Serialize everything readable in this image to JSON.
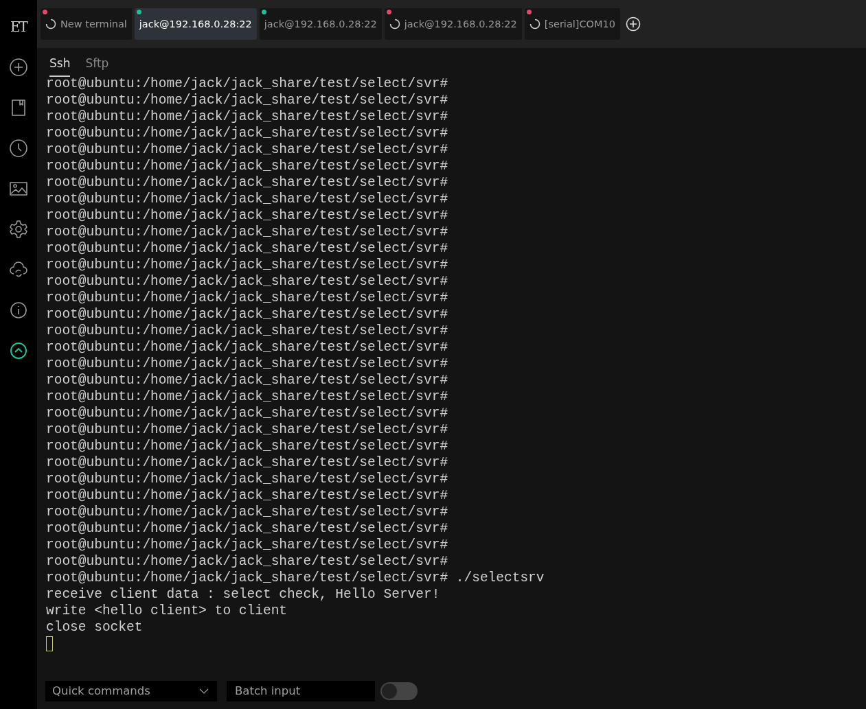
{
  "sidebar": {
    "logo": "ET"
  },
  "tabs": [
    {
      "label": "New terminal",
      "selected": false,
      "loading": true,
      "color": "#e8476a"
    },
    {
      "label": "jack@192.168.0.28:22",
      "selected": true,
      "loading": false,
      "color": "#19c39a"
    },
    {
      "label": "jack@192.168.0.28:22",
      "selected": false,
      "loading": false,
      "color": "#19c39a"
    },
    {
      "label": "jack@192.168.0.28:22",
      "selected": false,
      "loading": true,
      "color": "#e8476a"
    },
    {
      "label": "[serial]COM10",
      "selected": false,
      "loading": true,
      "color": "#e8476a"
    }
  ],
  "sub_tabs": [
    {
      "label": "Ssh",
      "selected": true
    },
    {
      "label": "Sftp",
      "selected": false
    }
  ],
  "terminal": {
    "lines": [
      "root@ubuntu:/home/jack/jack_share/test/select/svr#",
      "root@ubuntu:/home/jack/jack_share/test/select/svr#",
      "root@ubuntu:/home/jack/jack_share/test/select/svr#",
      "root@ubuntu:/home/jack/jack_share/test/select/svr#",
      "root@ubuntu:/home/jack/jack_share/test/select/svr#",
      "root@ubuntu:/home/jack/jack_share/test/select/svr#",
      "root@ubuntu:/home/jack/jack_share/test/select/svr#",
      "root@ubuntu:/home/jack/jack_share/test/select/svr#",
      "root@ubuntu:/home/jack/jack_share/test/select/svr#",
      "root@ubuntu:/home/jack/jack_share/test/select/svr#",
      "root@ubuntu:/home/jack/jack_share/test/select/svr#",
      "root@ubuntu:/home/jack/jack_share/test/select/svr#",
      "root@ubuntu:/home/jack/jack_share/test/select/svr#",
      "root@ubuntu:/home/jack/jack_share/test/select/svr#",
      "root@ubuntu:/home/jack/jack_share/test/select/svr#",
      "root@ubuntu:/home/jack/jack_share/test/select/svr#",
      "root@ubuntu:/home/jack/jack_share/test/select/svr#",
      "root@ubuntu:/home/jack/jack_share/test/select/svr#",
      "root@ubuntu:/home/jack/jack_share/test/select/svr#",
      "root@ubuntu:/home/jack/jack_share/test/select/svr#",
      "root@ubuntu:/home/jack/jack_share/test/select/svr#",
      "root@ubuntu:/home/jack/jack_share/test/select/svr#",
      "root@ubuntu:/home/jack/jack_share/test/select/svr#",
      "root@ubuntu:/home/jack/jack_share/test/select/svr#",
      "root@ubuntu:/home/jack/jack_share/test/select/svr#",
      "root@ubuntu:/home/jack/jack_share/test/select/svr#",
      "root@ubuntu:/home/jack/jack_share/test/select/svr#",
      "root@ubuntu:/home/jack/jack_share/test/select/svr#",
      "root@ubuntu:/home/jack/jack_share/test/select/svr#",
      "root@ubuntu:/home/jack/jack_share/test/select/svr#",
      "root@ubuntu:/home/jack/jack_share/test/select/svr# ./selectsrv",
      "receive client data : select check, Hello Server!",
      "write <hello client> to client",
      "close socket"
    ]
  },
  "bottom": {
    "quick_commands": {
      "placeholder": "Quick commands"
    },
    "batch_input": {
      "placeholder": "Batch input"
    },
    "toggle": {
      "on": false
    }
  }
}
